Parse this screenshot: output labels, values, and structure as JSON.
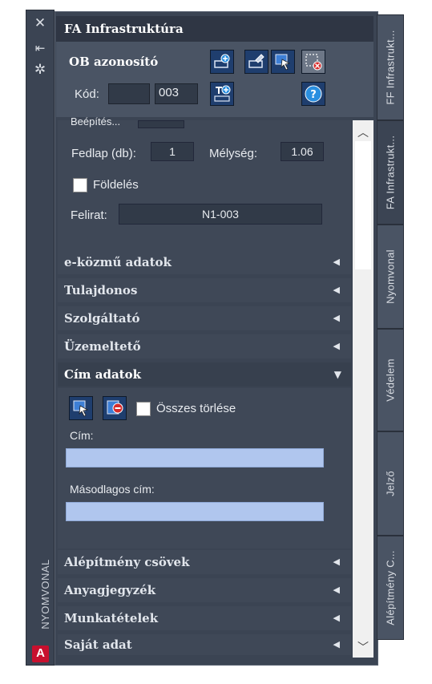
{
  "left_strip": {
    "icons": [
      "close-icon",
      "pin-icon",
      "settings-icon"
    ],
    "vertical_title": "NYOMVONAL",
    "logo_letter": "A"
  },
  "panel": {
    "title": "FA Infrastruktúra",
    "ob": {
      "title": "OB azonosító",
      "kod_label": "Kód:",
      "kod_prefix_value": "",
      "kod_number_value": "003"
    },
    "section_top": {
      "partial_label": "Beépítés...",
      "fedlap_label": "Fedlap (db):",
      "fedlap_value": "1",
      "melyseg_label": "Mélység:",
      "melyseg_value": "1.06",
      "foldeles_label": "Földelés",
      "felirat_label": "Felirat:",
      "felirat_value": "N1-003"
    },
    "accordions": [
      {
        "label": "e-közmű adatok"
      },
      {
        "label": "Tulajdonos"
      },
      {
        "label": "Szolgáltató"
      },
      {
        "label": "Üzemeltető"
      },
      {
        "label": "Cím adatok"
      },
      {
        "label": "Alépítmény csövek"
      },
      {
        "label": "Anyagjegyzék"
      },
      {
        "label": "Munkatételek"
      },
      {
        "label": "Saját adat"
      }
    ],
    "cim": {
      "osszes_torlese_label": "Összes törlése",
      "cim_label": "Cím:",
      "cim_value": "",
      "masodlagos_label": "Másodlagos cím:",
      "masodlagos_value": ""
    }
  },
  "right_tabs": [
    {
      "label": "FF Infrastrukt..."
    },
    {
      "label": "FA Infrastrukt..."
    },
    {
      "label": "Nyomvonal"
    },
    {
      "label": "Védelem"
    },
    {
      "label": "Jelző"
    },
    {
      "label": "Alépítmény C..."
    }
  ],
  "colors": {
    "panel_bg": "#3b4453",
    "header_bg": "#4a5464",
    "input_highlight": "#b0c6ee",
    "icon_button_bg": "#1f3e6e"
  }
}
